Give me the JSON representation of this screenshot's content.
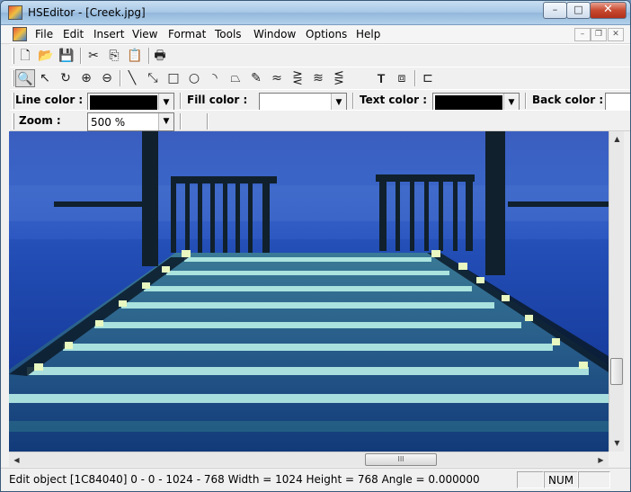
{
  "window": {
    "title": "HSEditor - [Creek.jpg]",
    "minimize": "–",
    "maximize": "□",
    "close": "✕"
  },
  "menu": [
    "File",
    "Edit",
    "Insert",
    "View",
    "Format",
    "Tools",
    "Window",
    "Options",
    "Help"
  ],
  "mdi_controls": {
    "minimize": "–",
    "restore": "❐",
    "close": "✕"
  },
  "toolbar_main": {
    "new": "🗋",
    "open": "📂",
    "save": "💾",
    "cut": "✂",
    "copy": "⎘",
    "paste": "📋",
    "print": "🖶"
  },
  "toolbar_draw": {
    "zoom_select": "🔍",
    "pointer": "↖",
    "rotate": "↻",
    "zoom_in": "⊕",
    "zoom_out": "⊖",
    "line": "╲",
    "arrow_line": "⤡",
    "rectangle": "□",
    "ellipse": "○",
    "arc": "◝",
    "polygon": "⏢",
    "pencil": "✎",
    "curve": "≈",
    "multi_curve": "⋛",
    "bezier": "≋",
    "freehand": "⋚",
    "text": "T",
    "image": "⧈",
    "group": "⊏"
  },
  "format_bar": {
    "line_color_label": "Line color :",
    "fill_color_label": "Fill color :",
    "text_color_label": "Text color :",
    "back_color_label": "Back color :",
    "line_color": "#000000",
    "fill_color": "#ffffff",
    "text_color": "#000000"
  },
  "zoom_bar": {
    "label": "Zoom :",
    "value": "500 %"
  },
  "scroll": {
    "up": "▲",
    "down": "▼",
    "left": "◀",
    "right": "▶",
    "grip": "III"
  },
  "status": {
    "text": "Edit object [1C84040] 0 - 0 - 1024 - 768  Width = 1024  Height = 768 Angle = 0.000000",
    "num": "NUM"
  },
  "colors": {
    "sky": "#3a66c8",
    "sea": "#1a45b0",
    "pier_light": "#b8f0e8",
    "post": "#10202c"
  }
}
